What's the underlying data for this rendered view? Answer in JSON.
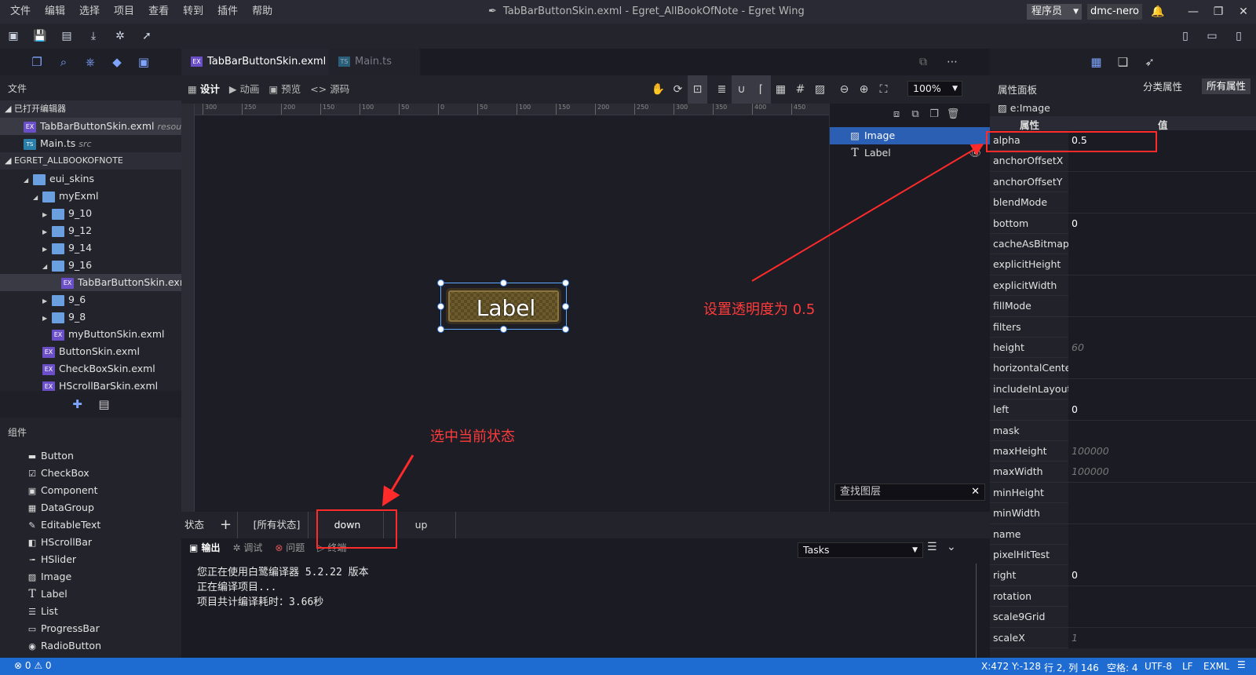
{
  "window": {
    "title": "TabBarButtonSkin.exml - Egret_AllBookOfNote - Egret Wing",
    "role": "程序员",
    "user": "dmc-nero"
  },
  "menu": [
    "文件",
    "编辑",
    "选择",
    "项目",
    "查看",
    "转到",
    "插件",
    "帮助"
  ],
  "left": {
    "files_header": "文件",
    "open_editors": "已打开编辑器",
    "open_items": [
      {
        "name": "TabBarButtonSkin.exml",
        "sub": "resour..."
      },
      {
        "name": "Main.ts",
        "sub": "src"
      }
    ],
    "project": "EGRET_ALLBOOKOFNOTE",
    "tree": [
      "eui_skins",
      "myExml",
      "9_10",
      "9_12",
      "9_14",
      "9_16",
      "TabBarButtonSkin.exml",
      "9_6",
      "9_8",
      "myButtonSkin.exml",
      "ButtonSkin.exml",
      "CheckBoxSkin.exml",
      "HScrollBarSkin.exml"
    ],
    "components_header": "组件",
    "components": [
      "Button",
      "CheckBox",
      "Component",
      "DataGroup",
      "EditableText",
      "HScrollBar",
      "HSlider",
      "Image",
      "Label",
      "List",
      "ProgressBar",
      "RadioButton"
    ]
  },
  "editor": {
    "tabs": [
      "TabBarButtonSkin.exml",
      "Main.ts"
    ],
    "close": "✕",
    "modes": [
      "设计",
      "动画",
      "预览",
      "源码"
    ],
    "zoom": "100%",
    "ruler": [
      "300",
      "250",
      "200",
      "150",
      "100",
      "50",
      "0",
      "50",
      "100",
      "150",
      "200",
      "250",
      "300",
      "350",
      "400",
      "450"
    ],
    "skin_label": "Label",
    "layers": [
      "Image",
      "Label"
    ],
    "layer_search": "查找图层",
    "states_label": "状态",
    "states": [
      "[所有状态]",
      "down",
      "up"
    ],
    "output_tabs": [
      "输出",
      "调试",
      "问题",
      "终端"
    ],
    "tasks": "Tasks",
    "output": [
      "您正在使用白鹭编译器 5.2.22 版本",
      "正在编译项目...",
      "项目共计编译耗时：3.66秒"
    ]
  },
  "props": {
    "title": "属性面板",
    "category": "分类属性",
    "all": "所有属性",
    "object": "e:Image",
    "col_name": "属性",
    "col_value": "值",
    "rows": [
      {
        "n": "alpha",
        "v": "0.5",
        "ph": false
      },
      {
        "n": "anchorOffsetX",
        "v": "",
        "ph": false
      },
      {
        "n": "anchorOffsetY",
        "v": "",
        "ph": false
      },
      {
        "n": "blendMode",
        "v": "",
        "ph": false
      },
      {
        "n": "bottom",
        "v": "0",
        "ph": false
      },
      {
        "n": "cacheAsBitmap",
        "v": "",
        "ph": false
      },
      {
        "n": "explicitHeight",
        "v": "",
        "ph": false
      },
      {
        "n": "explicitWidth",
        "v": "",
        "ph": false
      },
      {
        "n": "fillMode",
        "v": "",
        "ph": false
      },
      {
        "n": "filters",
        "v": "",
        "ph": false
      },
      {
        "n": "height",
        "v": "60",
        "ph": true
      },
      {
        "n": "horizontalCenter",
        "v": "",
        "ph": false
      },
      {
        "n": "includeInLayout",
        "v": "",
        "ph": false
      },
      {
        "n": "left",
        "v": "0",
        "ph": false
      },
      {
        "n": "mask",
        "v": "",
        "ph": false
      },
      {
        "n": "maxHeight",
        "v": "100000",
        "ph": true
      },
      {
        "n": "maxWidth",
        "v": "100000",
        "ph": true
      },
      {
        "n": "minHeight",
        "v": "",
        "ph": false
      },
      {
        "n": "minWidth",
        "v": "",
        "ph": false
      },
      {
        "n": "name",
        "v": "",
        "ph": false
      },
      {
        "n": "pixelHitTest",
        "v": "",
        "ph": false
      },
      {
        "n": "right",
        "v": "0",
        "ph": false
      },
      {
        "n": "rotation",
        "v": "",
        "ph": false
      },
      {
        "n": "scale9Grid",
        "v": "",
        "ph": false
      },
      {
        "n": "scaleX",
        "v": "1",
        "ph": true
      }
    ]
  },
  "status": {
    "errors": "0",
    "warnings": "0",
    "coords": "X:472 Y:-128",
    "pos": "行 2, 列 146",
    "spaces": "空格: 4",
    "encoding": "UTF-8",
    "eol": "LF",
    "lang": "EXML"
  },
  "annotations": {
    "alpha": "设置透明度为 0.5",
    "state": "选中当前状态"
  },
  "colors": {
    "accent": "#1e6bd1",
    "selection": "#2b5fb4",
    "annotation": "#ff2a2a"
  }
}
